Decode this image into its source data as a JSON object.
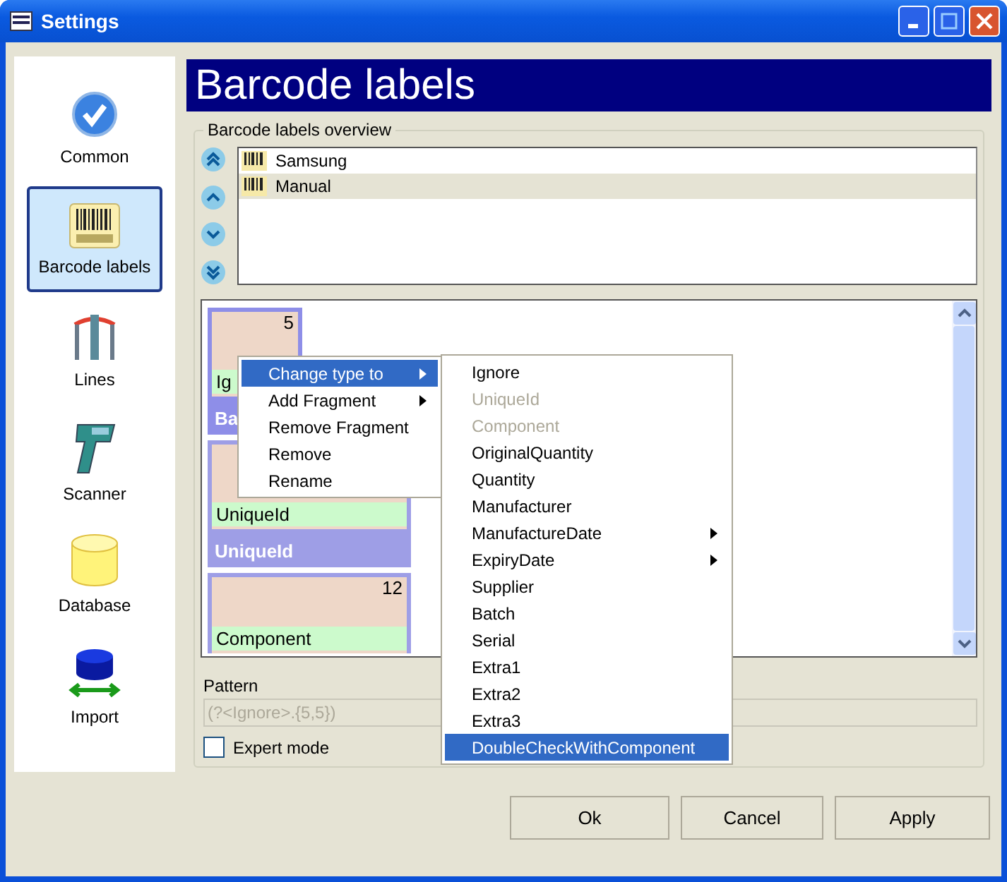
{
  "window": {
    "title": "Settings"
  },
  "sidebar": {
    "items": [
      {
        "label": "Common",
        "selected": false
      },
      {
        "label": "Barcode labels",
        "selected": true
      },
      {
        "label": "Lines",
        "selected": false
      },
      {
        "label": "Scanner",
        "selected": false
      },
      {
        "label": "Database",
        "selected": false
      },
      {
        "label": "Import",
        "selected": false
      }
    ]
  },
  "header": "Barcode labels",
  "overview": {
    "title": "Barcode labels overview",
    "labels": [
      {
        "name": "Samsung",
        "selected": false
      },
      {
        "name": "Manual",
        "selected": true
      }
    ]
  },
  "fragments": [
    {
      "length": "5",
      "type": "Ig",
      "name": "Ba"
    },
    {
      "type": "UniqueId",
      "name": "UniqueId"
    },
    {
      "length": "12",
      "type": "Component"
    }
  ],
  "pattern": {
    "label": "Pattern",
    "value": "(?<Ignore>.{5,5})",
    "disabled": true
  },
  "expert_mode": {
    "label": "Expert mode",
    "checked": false
  },
  "context_menu": {
    "items": [
      {
        "label": "Change type to",
        "submenu": true,
        "selected": true
      },
      {
        "label": "Add Fragment",
        "submenu": true,
        "selected": false
      },
      {
        "label": "Remove Fragment",
        "submenu": false,
        "selected": false
      },
      {
        "label": "Remove",
        "submenu": false,
        "selected": false
      },
      {
        "label": "Rename",
        "submenu": false,
        "selected": false
      }
    ]
  },
  "type_menu": {
    "items": [
      {
        "label": "Ignore",
        "disabled": false,
        "submenu": false,
        "selected": false
      },
      {
        "label": "UniqueId",
        "disabled": true,
        "submenu": false,
        "selected": false
      },
      {
        "label": "Component",
        "disabled": true,
        "submenu": false,
        "selected": false
      },
      {
        "label": "OriginalQuantity",
        "disabled": false,
        "submenu": false,
        "selected": false
      },
      {
        "label": "Quantity",
        "disabled": false,
        "submenu": false,
        "selected": false
      },
      {
        "label": "Manufacturer",
        "disabled": false,
        "submenu": false,
        "selected": false
      },
      {
        "label": "ManufactureDate",
        "disabled": false,
        "submenu": true,
        "selected": false
      },
      {
        "label": "ExpiryDate",
        "disabled": false,
        "submenu": true,
        "selected": false
      },
      {
        "label": "Supplier",
        "disabled": false,
        "submenu": false,
        "selected": false
      },
      {
        "label": "Batch",
        "disabled": false,
        "submenu": false,
        "selected": false
      },
      {
        "label": "Serial",
        "disabled": false,
        "submenu": false,
        "selected": false
      },
      {
        "label": "Extra1",
        "disabled": false,
        "submenu": false,
        "selected": false
      },
      {
        "label": "Extra2",
        "disabled": false,
        "submenu": false,
        "selected": false
      },
      {
        "label": "Extra3",
        "disabled": false,
        "submenu": false,
        "selected": false
      },
      {
        "label": "DoubleCheckWithComponent",
        "disabled": false,
        "submenu": false,
        "selected": true
      }
    ]
  },
  "buttons": [
    "Ok",
    "Cancel",
    "Apply"
  ]
}
